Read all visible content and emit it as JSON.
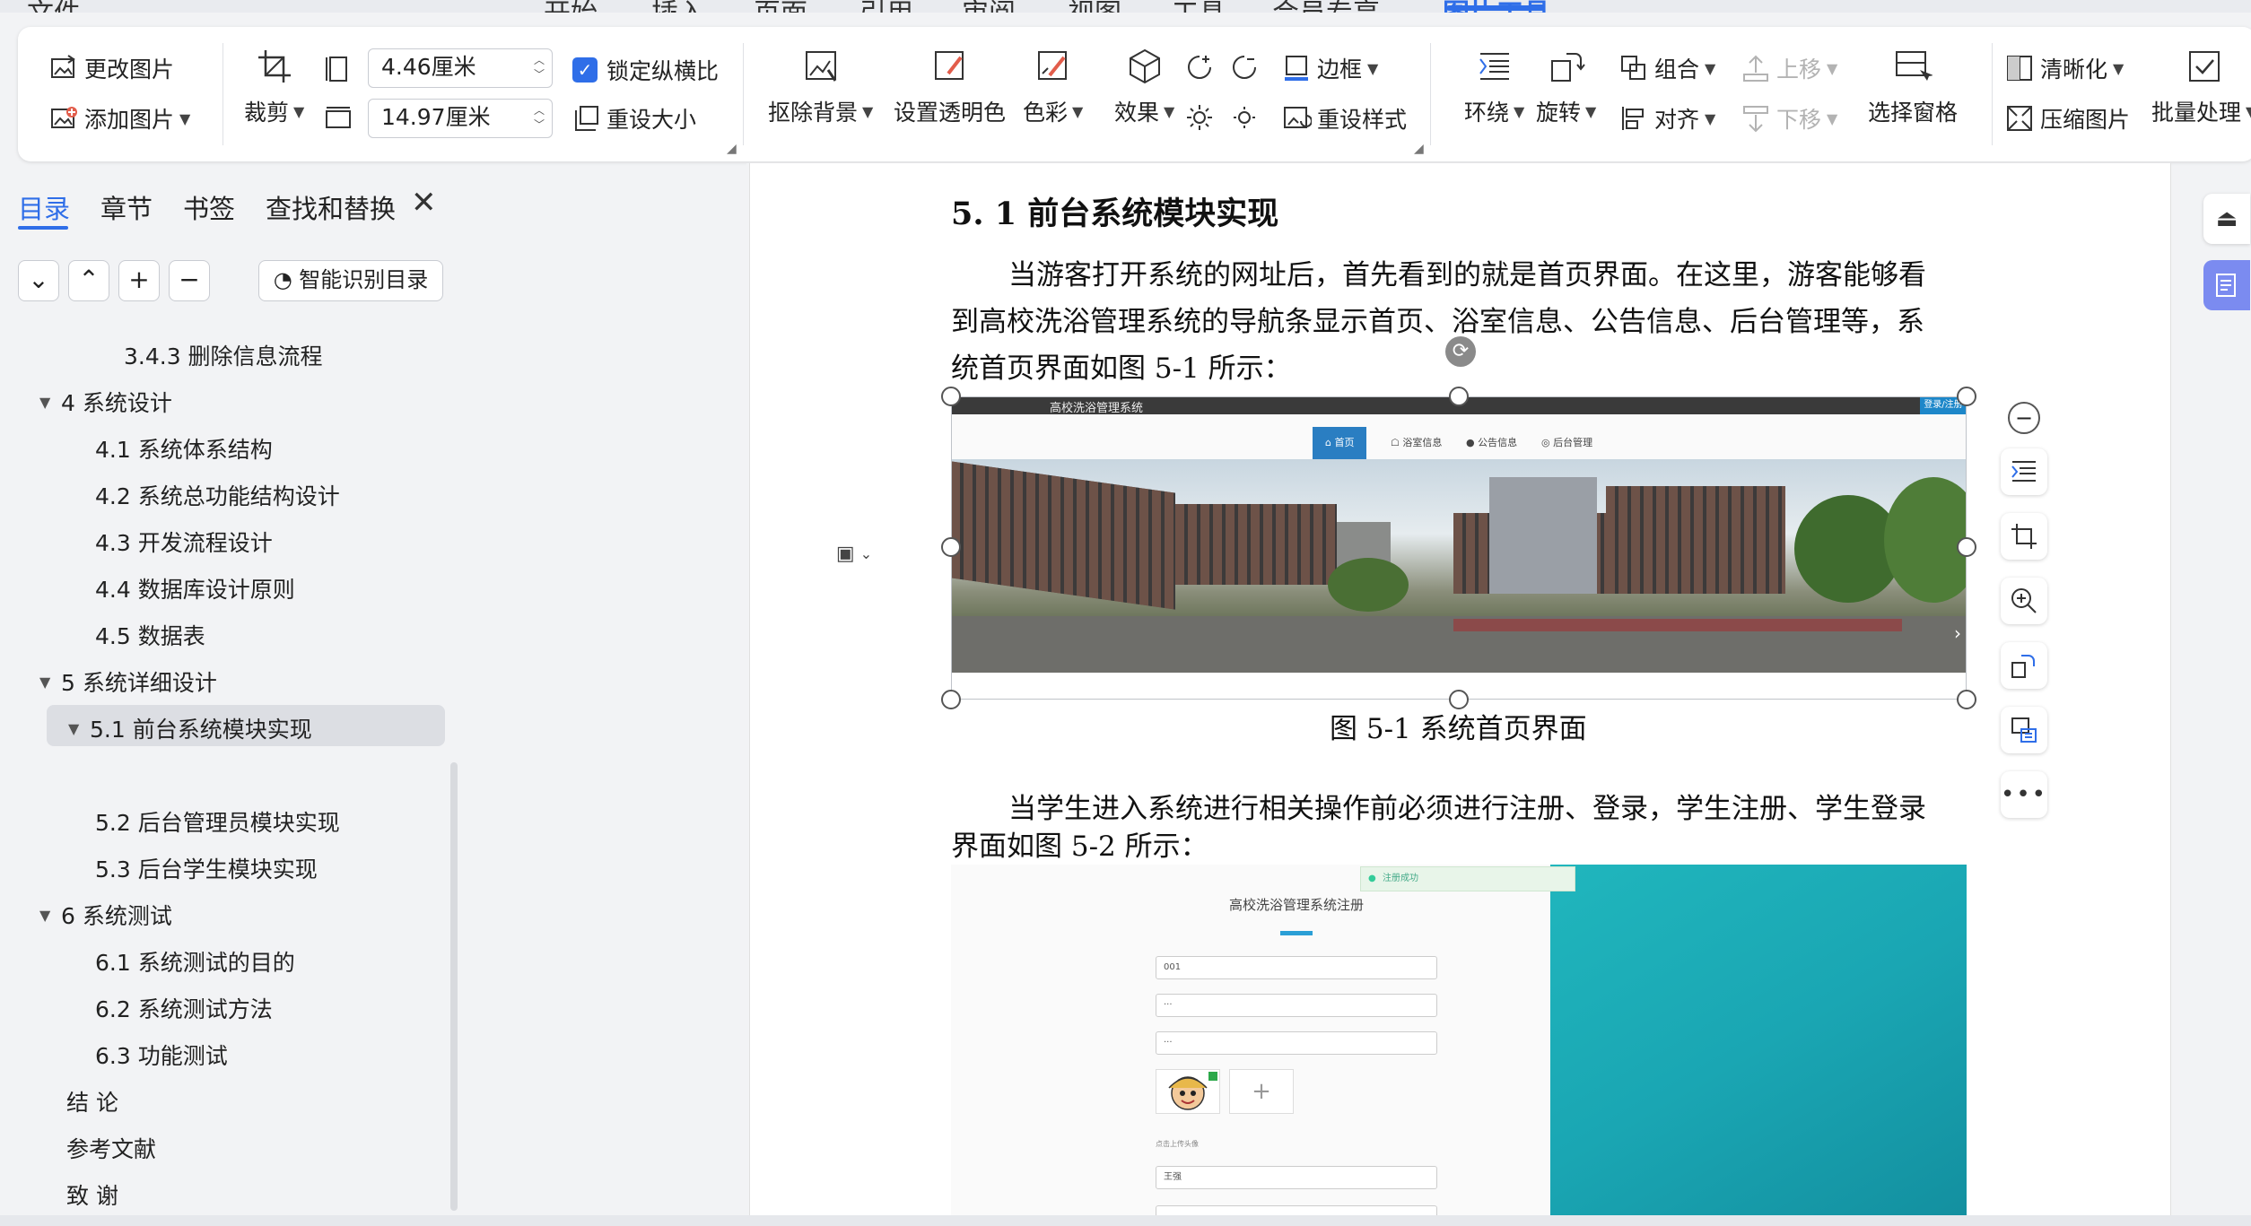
{
  "menu": {
    "tabs": [
      "文件",
      "开始",
      "插入",
      "页面",
      "引用",
      "审阅",
      "视图",
      "工具",
      "会员专享",
      "图片工具"
    ],
    "active": "图片工具"
  },
  "ribbon": {
    "change_picture": "更改图片",
    "add_picture": "添加图片",
    "crop": "裁剪",
    "width_value": "4.46厘米",
    "height_value": "14.97厘米",
    "lock_aspect": "锁定纵横比",
    "reset_size": "重设大小",
    "remove_background": "抠除背景",
    "set_transparent": "设置透明色",
    "color": "色彩",
    "effects": "效果",
    "border": "边框",
    "reset_style": "重设样式",
    "wrap": "环绕",
    "rotate": "旋转",
    "group": "组合",
    "align": "对齐",
    "bring_forward": "上移",
    "send_backward": "下移",
    "selection_pane": "选择窗格",
    "sharpen": "清晰化",
    "compress": "压缩图片",
    "batch": "批量处理"
  },
  "nav": {
    "tabs": [
      "目录",
      "章节",
      "书签",
      "查找和替换"
    ],
    "active_tab": "目录",
    "smart_toc": "智能识别目录",
    "toc": [
      {
        "label": "3.4.3 删除信息流程",
        "level": 3
      },
      {
        "label": "4  系统设计",
        "level": 1,
        "expanded": true
      },
      {
        "label": "4.1  系统体系结构",
        "level": 2
      },
      {
        "label": "4.2  系统总功能结构设计",
        "level": 2
      },
      {
        "label": "4.3 开发流程设计",
        "level": 2
      },
      {
        "label": "4.4  数据库设计原则",
        "level": 2
      },
      {
        "label": "4.5  数据表",
        "level": 2
      },
      {
        "label": "5  系统详细设计",
        "level": 1,
        "expanded": true
      },
      {
        "label": "5.1 前台系统模块实现",
        "level": 2,
        "selected": true
      },
      {
        "label": "5.2 后台管理员模块实现",
        "level": 2
      },
      {
        "label": "5.3 后台学生模块实现",
        "level": 2
      },
      {
        "label": "6    系统测试",
        "level": 1,
        "expanded": true
      },
      {
        "label": "6.1 系统测试的目的",
        "level": 2
      },
      {
        "label": "6.2 系统测试方法",
        "level": 2
      },
      {
        "label": "6.3 功能测试",
        "level": 2
      },
      {
        "label": "结  论",
        "level": 1
      },
      {
        "label": "参考文献",
        "level": 1
      },
      {
        "label": "致  谢",
        "level": 1
      }
    ]
  },
  "doc": {
    "heading": "5. 1 前台系统模块实现",
    "para1_lines": [
      "当游客打开系统的网址后，首先看到的就是首页界面。在这里，游客能够看",
      "到高校洗浴管理系统的导航条显示首页、浴室信息、公告信息、后台管理等，系",
      "统首页界面如图 5-1 所示："
    ],
    "caption1": "图 5-1  系统首页界面",
    "para2_lines": [
      "当学生进入系统进行相关操作前必须进行注册、登录，学生注册、学生登录",
      "界面如图 5-2 所示："
    ]
  },
  "homepage_shot": {
    "site_title": "高校洗浴管理系统",
    "login_btn": "登录/注册",
    "nav": [
      "⌂ 首页",
      "☖ 浴室信息",
      "● 公告信息",
      "◎ 后台管理"
    ]
  },
  "register_shot": {
    "toast": "注册成功",
    "title": "高校洗浴管理系统注册",
    "field1": "001",
    "field2": "···",
    "field3": "···",
    "upload_hint": "点击上传头像",
    "name_field": "王强"
  },
  "colors": {
    "accent": "#2f6ee8",
    "teal": "#1aa6b3"
  }
}
